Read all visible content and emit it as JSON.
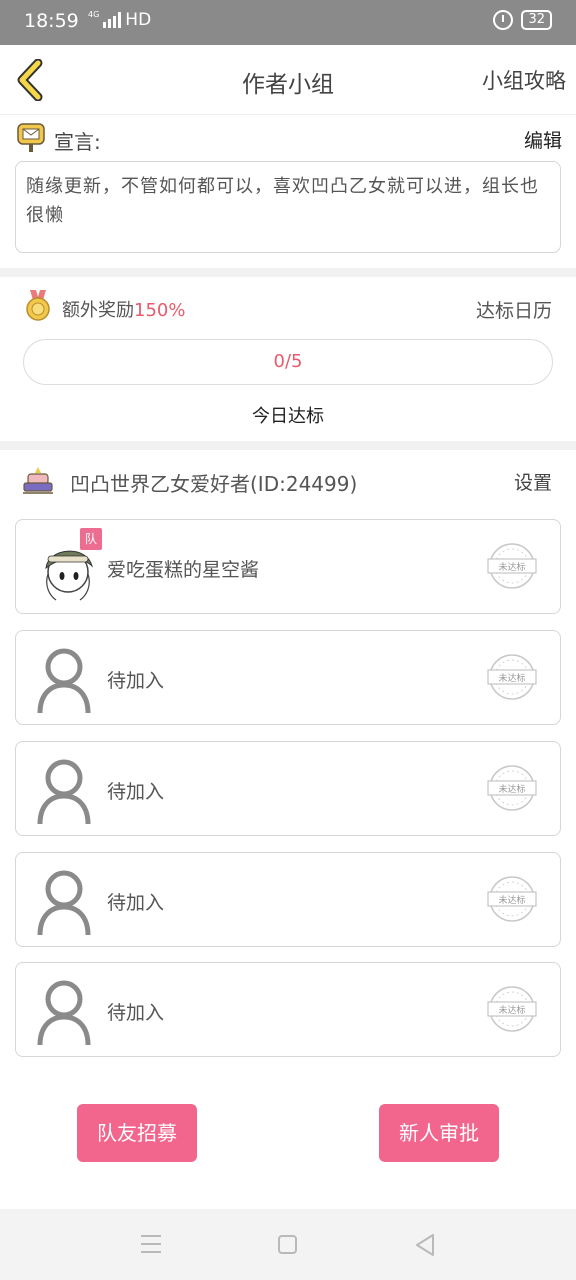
{
  "status_bar": {
    "time": "18:59",
    "network": "HD",
    "network_small": "4G",
    "battery": "32"
  },
  "nav": {
    "title": "作者小组",
    "right_label": "小组攻略"
  },
  "manifesto": {
    "label": "宣言:",
    "edit_label": "编辑",
    "text": "随缘更新，不管如何都可以，喜欢凹凸乙女就可以进，组长也很懒"
  },
  "reward": {
    "label": "额外奖励",
    "value": "150%",
    "calendar_label": "达标日历",
    "progress_text": "0/5",
    "today_label": "今日达标"
  },
  "group": {
    "name": "凹凸世界乙女爱好者(ID:24499)",
    "settings_label": "设置"
  },
  "members": [
    {
      "name": "爱吃蛋糕的星空酱",
      "badge": "队",
      "stamp": "未达标"
    },
    {
      "name": "待加入",
      "stamp": "未达标"
    },
    {
      "name": "待加入",
      "stamp": "未达标"
    },
    {
      "name": "待加入",
      "stamp": "未达标"
    },
    {
      "name": "待加入",
      "stamp": "未达标"
    }
  ],
  "actions": {
    "recruit_label": "队友招募",
    "approve_label": "新人审批"
  },
  "colors": {
    "accent_pink": "#f2658d",
    "highlight_red": "#e85b6c",
    "back_arrow": "#f5d74a",
    "status_bar": "#8a8a8a"
  },
  "icons": [
    "back-arrow-icon",
    "mailbox-icon",
    "medal-icon",
    "throne-icon",
    "person-placeholder-icon",
    "not-qualified-stamp-icon"
  ]
}
